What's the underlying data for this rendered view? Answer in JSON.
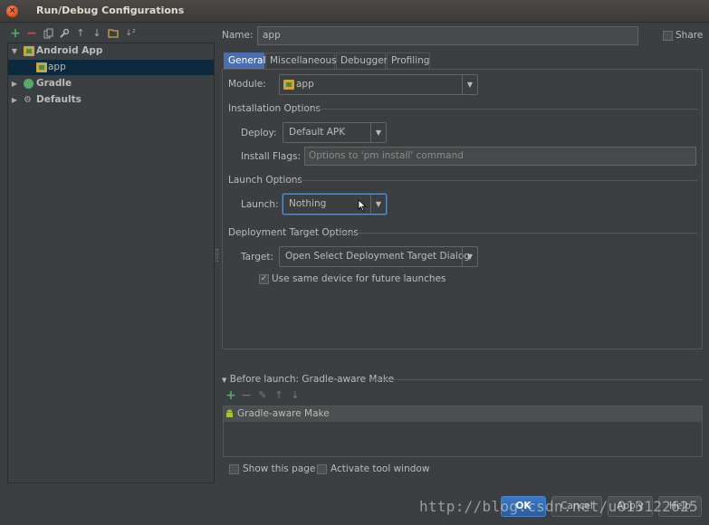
{
  "window": {
    "title": "Run/Debug Configurations"
  },
  "toolbar": {
    "icons": [
      "add-icon",
      "remove-icon",
      "copy-icon",
      "wrench-icon",
      "move-up-icon",
      "move-down-icon",
      "folder-icon",
      "sort-icon"
    ]
  },
  "tree": {
    "items": [
      {
        "label": "Android App",
        "expanded": true
      },
      {
        "label": "app",
        "selected": true
      },
      {
        "label": "Gradle",
        "expanded": false
      },
      {
        "label": "Defaults",
        "expanded": false
      }
    ]
  },
  "header": {
    "name_label": "Name:",
    "name_value": "app",
    "share_label": "Share"
  },
  "tabs": [
    {
      "label": "General",
      "active": true
    },
    {
      "label": "Miscellaneous"
    },
    {
      "label": "Debugger"
    },
    {
      "label": "Profiling"
    }
  ],
  "general": {
    "module_label": "Module:",
    "module_value": "app",
    "installation_title": "Installation Options",
    "deploy_label": "Deploy:",
    "deploy_value": "Default APK",
    "install_flags_label": "Install Flags:",
    "install_flags_placeholder": "Options to 'pm install' command",
    "launch_title": "Launch Options",
    "launch_label": "Launch:",
    "launch_value": "Nothing",
    "deployment_title": "Deployment Target Options",
    "target_label": "Target:",
    "target_value": "Open Select Deployment Target Dialog",
    "same_device_label": "Use same device for future launches",
    "same_device_checked": true
  },
  "before_launch": {
    "title": "Before launch: Gradle-aware Make",
    "items": [
      "Gradle-aware Make"
    ]
  },
  "footer": {
    "show_page_label": "Show this page",
    "activate_tool_label": "Activate tool window",
    "ok_label": "OK",
    "cancel_label": "Cancel",
    "apply_label": "Apply",
    "help_label": "Help"
  },
  "watermark": "http://blog.csdn.net/u013122625",
  "colors": {
    "background": "#3c3f41",
    "tab_active": "#4b6eaf",
    "selection": "#0d293e",
    "add_green": "#59a869",
    "remove_red": "#c75450",
    "focus_border": "#5e8ebf"
  }
}
